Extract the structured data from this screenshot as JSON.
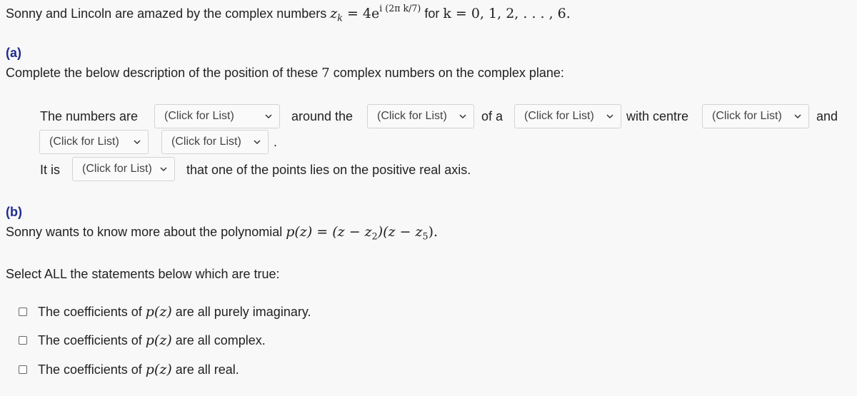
{
  "intro": {
    "text": "Sonny and Lincoln are amazed by the complex numbers",
    "formula_lhs": "z",
    "formula_sub": "k",
    "formula_eq": " = 4e",
    "formula_exp": "i (2π k/7)",
    "formula_for": " for ",
    "formula_range": "k = 0, 1, 2, . . . , 6."
  },
  "part_a": {
    "label": "(a)",
    "instruction_pre": "Complete the below description of the position of these ",
    "instruction_num": "7",
    "instruction_post": " complex numbers on the complex plane:",
    "text_numbers_are": "The numbers are",
    "text_around_the": "around the",
    "text_of_a": "of a",
    "text_with_centre": "with centre",
    "text_and": "and",
    "text_period": ".",
    "text_it_is": "It is",
    "text_positive_axis": "that one of the points lies on the positive real axis.",
    "dropdowns": [
      {
        "value": "(Click for List)"
      },
      {
        "value": "(Click for List)"
      },
      {
        "value": "(Click for List)"
      },
      {
        "value": "(Click for List)"
      },
      {
        "value": "(Click for List)"
      },
      {
        "value": "(Click for List)"
      },
      {
        "value": "(Click for List)"
      }
    ]
  },
  "part_b": {
    "label": "(b)",
    "text_pre": "Sonny wants to know more about the polynomial ",
    "poly": "p(z) = (z − z",
    "poly_sub1": "2",
    "poly_mid": ")(z − z",
    "poly_sub2": "5",
    "poly_end": ").",
    "select_all": "Select ALL the statements below which are true:",
    "options": [
      {
        "pre": "The coefficients of ",
        "math": "p(z)",
        "post": " are all purely imaginary.",
        "checked": false
      },
      {
        "pre": "The coefficients of ",
        "math": "p(z)",
        "post": " are all complex.",
        "checked": false
      },
      {
        "pre": "The coefficients of ",
        "math": "p(z)",
        "post": " are all real.",
        "checked": false
      }
    ]
  }
}
